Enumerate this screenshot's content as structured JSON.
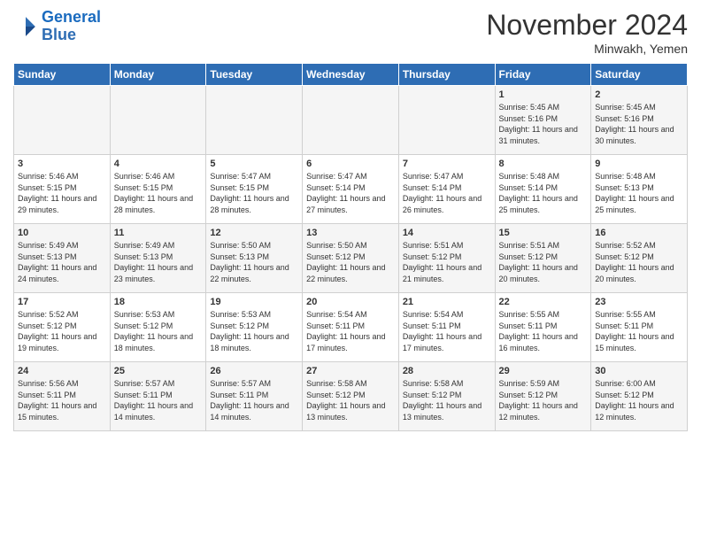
{
  "logo": {
    "line1": "General",
    "line2": "Blue"
  },
  "title": "November 2024",
  "location": "Minwakh, Yemen",
  "days_of_week": [
    "Sunday",
    "Monday",
    "Tuesday",
    "Wednesday",
    "Thursday",
    "Friday",
    "Saturday"
  ],
  "weeks": [
    [
      {
        "day": "",
        "content": ""
      },
      {
        "day": "",
        "content": ""
      },
      {
        "day": "",
        "content": ""
      },
      {
        "day": "",
        "content": ""
      },
      {
        "day": "",
        "content": ""
      },
      {
        "day": "1",
        "content": "Sunrise: 5:45 AM\nSunset: 5:16 PM\nDaylight: 11 hours\nand 31 minutes."
      },
      {
        "day": "2",
        "content": "Sunrise: 5:45 AM\nSunset: 5:16 PM\nDaylight: 11 hours\nand 30 minutes."
      }
    ],
    [
      {
        "day": "3",
        "content": "Sunrise: 5:46 AM\nSunset: 5:15 PM\nDaylight: 11 hours\nand 29 minutes."
      },
      {
        "day": "4",
        "content": "Sunrise: 5:46 AM\nSunset: 5:15 PM\nDaylight: 11 hours\nand 28 minutes."
      },
      {
        "day": "5",
        "content": "Sunrise: 5:47 AM\nSunset: 5:15 PM\nDaylight: 11 hours\nand 28 minutes."
      },
      {
        "day": "6",
        "content": "Sunrise: 5:47 AM\nSunset: 5:14 PM\nDaylight: 11 hours\nand 27 minutes."
      },
      {
        "day": "7",
        "content": "Sunrise: 5:47 AM\nSunset: 5:14 PM\nDaylight: 11 hours\nand 26 minutes."
      },
      {
        "day": "8",
        "content": "Sunrise: 5:48 AM\nSunset: 5:14 PM\nDaylight: 11 hours\nand 25 minutes."
      },
      {
        "day": "9",
        "content": "Sunrise: 5:48 AM\nSunset: 5:13 PM\nDaylight: 11 hours\nand 25 minutes."
      }
    ],
    [
      {
        "day": "10",
        "content": "Sunrise: 5:49 AM\nSunset: 5:13 PM\nDaylight: 11 hours\nand 24 minutes."
      },
      {
        "day": "11",
        "content": "Sunrise: 5:49 AM\nSunset: 5:13 PM\nDaylight: 11 hours\nand 23 minutes."
      },
      {
        "day": "12",
        "content": "Sunrise: 5:50 AM\nSunset: 5:13 PM\nDaylight: 11 hours\nand 22 minutes."
      },
      {
        "day": "13",
        "content": "Sunrise: 5:50 AM\nSunset: 5:12 PM\nDaylight: 11 hours\nand 22 minutes."
      },
      {
        "day": "14",
        "content": "Sunrise: 5:51 AM\nSunset: 5:12 PM\nDaylight: 11 hours\nand 21 minutes."
      },
      {
        "day": "15",
        "content": "Sunrise: 5:51 AM\nSunset: 5:12 PM\nDaylight: 11 hours\nand 20 minutes."
      },
      {
        "day": "16",
        "content": "Sunrise: 5:52 AM\nSunset: 5:12 PM\nDaylight: 11 hours\nand 20 minutes."
      }
    ],
    [
      {
        "day": "17",
        "content": "Sunrise: 5:52 AM\nSunset: 5:12 PM\nDaylight: 11 hours\nand 19 minutes."
      },
      {
        "day": "18",
        "content": "Sunrise: 5:53 AM\nSunset: 5:12 PM\nDaylight: 11 hours\nand 18 minutes."
      },
      {
        "day": "19",
        "content": "Sunrise: 5:53 AM\nSunset: 5:12 PM\nDaylight: 11 hours\nand 18 minutes."
      },
      {
        "day": "20",
        "content": "Sunrise: 5:54 AM\nSunset: 5:11 PM\nDaylight: 11 hours\nand 17 minutes."
      },
      {
        "day": "21",
        "content": "Sunrise: 5:54 AM\nSunset: 5:11 PM\nDaylight: 11 hours\nand 17 minutes."
      },
      {
        "day": "22",
        "content": "Sunrise: 5:55 AM\nSunset: 5:11 PM\nDaylight: 11 hours\nand 16 minutes."
      },
      {
        "day": "23",
        "content": "Sunrise: 5:55 AM\nSunset: 5:11 PM\nDaylight: 11 hours\nand 15 minutes."
      }
    ],
    [
      {
        "day": "24",
        "content": "Sunrise: 5:56 AM\nSunset: 5:11 PM\nDaylight: 11 hours\nand 15 minutes."
      },
      {
        "day": "25",
        "content": "Sunrise: 5:57 AM\nSunset: 5:11 PM\nDaylight: 11 hours\nand 14 minutes."
      },
      {
        "day": "26",
        "content": "Sunrise: 5:57 AM\nSunset: 5:11 PM\nDaylight: 11 hours\nand 14 minutes."
      },
      {
        "day": "27",
        "content": "Sunrise: 5:58 AM\nSunset: 5:12 PM\nDaylight: 11 hours\nand 13 minutes."
      },
      {
        "day": "28",
        "content": "Sunrise: 5:58 AM\nSunset: 5:12 PM\nDaylight: 11 hours\nand 13 minutes."
      },
      {
        "day": "29",
        "content": "Sunrise: 5:59 AM\nSunset: 5:12 PM\nDaylight: 11 hours\nand 12 minutes."
      },
      {
        "day": "30",
        "content": "Sunrise: 6:00 AM\nSunset: 5:12 PM\nDaylight: 11 hours\nand 12 minutes."
      }
    ]
  ]
}
